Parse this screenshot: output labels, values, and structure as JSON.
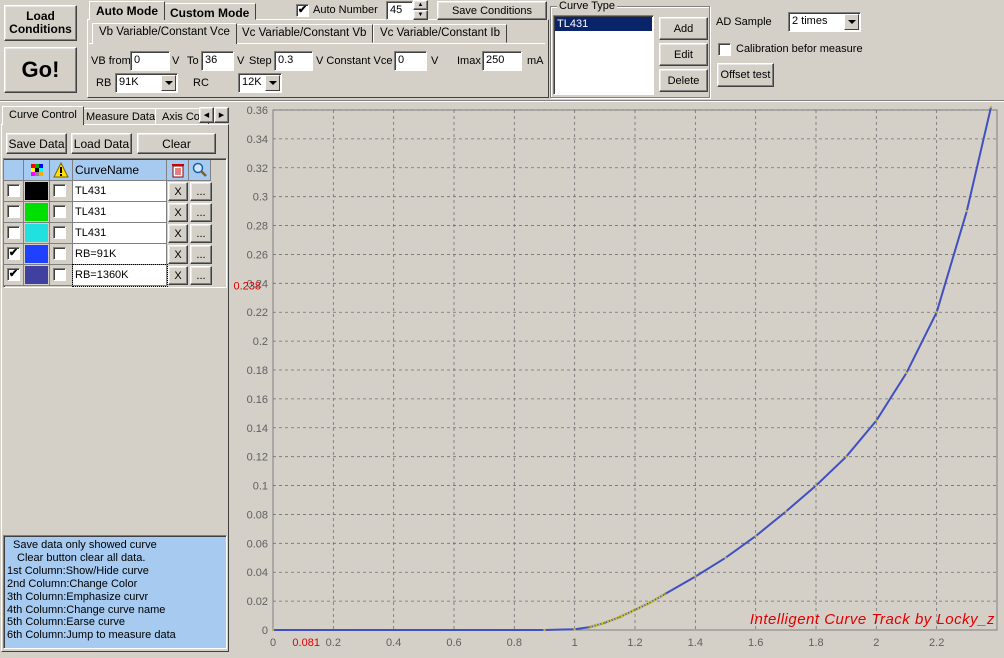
{
  "toolbar": {
    "load_conditions": "Load\nConditions",
    "go": "Go!"
  },
  "modes": {
    "auto": "Auto Mode",
    "custom": "Custom Mode",
    "auto_number_label": "Auto Number",
    "auto_number_checked": true,
    "auto_number_value": "45",
    "save_conditions": "Save Conditions"
  },
  "subtabs": [
    "Vb Variable/Constant Vce",
    "Vc Variable/Constant Vb",
    "Vc Variable/Constant Ib"
  ],
  "params": {
    "vb_from_label": "VB from",
    "vb_from": "0",
    "v1": "V",
    "to_label": "To",
    "to": "36",
    "v2": "V",
    "step_label": "Step",
    "step": "0.3",
    "v_const_label": "V Constant Vce",
    "vce": "0",
    "v3": "V",
    "imax_label": "Imax",
    "imax": "250",
    "ma": "mA",
    "rb_label": "RB",
    "rb": "91K",
    "rc_label": "RC",
    "rc": "12K"
  },
  "curve_type": {
    "title": "Curve Type",
    "items": [
      "TL431"
    ],
    "add": "Add",
    "edit": "Edit",
    "delete": "Delete"
  },
  "ad": {
    "label": "AD Sample",
    "value": "2 times",
    "calibration": "Calibration befor measure",
    "offset": "Offset test"
  },
  "left_tabs": [
    "Curve Control",
    "Measure Data",
    "Axis Co"
  ],
  "left_buttons": {
    "save": "Save Data",
    "load": "Load Data",
    "clear": "Clear"
  },
  "table": {
    "header_name": "CurveName",
    "rows": [
      {
        "show": false,
        "color": "#000000",
        "emph": false,
        "name": "TL431"
      },
      {
        "show": false,
        "color": "#00e000",
        "emph": false,
        "name": "TL431"
      },
      {
        "show": false,
        "color": "#20e0e0",
        "emph": false,
        "name": "TL431"
      },
      {
        "show": true,
        "color": "#2040ff",
        "emph": false,
        "name": "RB=91K"
      },
      {
        "show": true,
        "color": "#4040a0",
        "emph": false,
        "name": "RB=1360K"
      }
    ],
    "erase_label": "X",
    "jump_label": "..."
  },
  "help": [
    "Save data only showed curve",
    "Clear button clear all data.",
    "1st Column:Show/Hide curve",
    "2nd Column:Change Color",
    "3th Column:Emphasize curvr",
    "4th Column:Change curve name",
    "5th Column:Earse curve",
    "6th Column:Jump to measure data"
  ],
  "chart_data": {
    "type": "line",
    "xlim": [
      0,
      2.4
    ],
    "ylim": [
      0,
      0.36
    ],
    "x_ticks": [
      "0",
      "0.2",
      "0.4",
      "0.6",
      "0.8",
      "1",
      "1.2",
      "1.4",
      "1.6",
      "1.8",
      "2",
      "2.2"
    ],
    "y_ticks": [
      "0",
      "0.02",
      "0.04",
      "0.06",
      "0.08",
      "0.1",
      "0.12",
      "0.14",
      "0.16",
      "0.18",
      "0.2",
      "0.22",
      "0.24",
      "0.26",
      "0.28",
      "0.3",
      "0.32",
      "0.34",
      "0.36"
    ],
    "cursor_x": "0.081",
    "cursor_y": "0.238",
    "watermark": "Intelligent Curve Track by Locky_z",
    "series": [
      {
        "color": "#4050c0",
        "x": [
          0,
          0.9,
          1.0,
          1.05,
          1.1,
          1.15,
          1.2,
          1.25,
          1.3,
          1.4,
          1.5,
          1.6,
          1.7,
          1.8,
          1.9,
          2.0,
          2.1,
          2.2,
          2.3,
          2.38
        ],
        "y": [
          0,
          0,
          0.0005,
          0.002,
          0.005,
          0.009,
          0.014,
          0.019,
          0.025,
          0.037,
          0.05,
          0.065,
          0.082,
          0.1,
          0.12,
          0.145,
          0.178,
          0.22,
          0.29,
          0.362
        ]
      },
      {
        "color": "#c8c040",
        "x": [
          1.05,
          1.1,
          1.15,
          1.2,
          1.25,
          1.3
        ],
        "y": [
          0.002,
          0.005,
          0.009,
          0.014,
          0.019,
          0.025
        ]
      }
    ]
  }
}
